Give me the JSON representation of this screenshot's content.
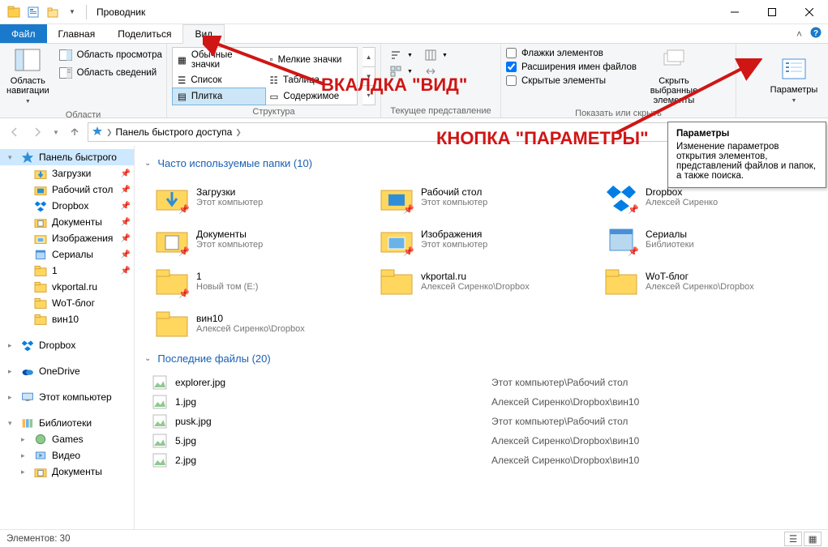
{
  "title": "Проводник",
  "tabs": {
    "file": "Файл",
    "home": "Главная",
    "share": "Поделиться",
    "view": "Вид"
  },
  "ribbon": {
    "panes": {
      "nav": "Область навигации",
      "preview": "Область просмотра",
      "details": "Область сведений",
      "group": "Области"
    },
    "layouts": {
      "huge": "Обычные значки",
      "small": "Мелкие значки",
      "list": "Список",
      "tiles": "Плитка",
      "table": "Таблица",
      "content": "Содержимое",
      "group": "Структура"
    },
    "view": {
      "group": "Текущее представление"
    },
    "show": {
      "checkboxes": "Флажки элементов",
      "extensions": "Расширения имен файлов",
      "hidden": "Скрытые элементы",
      "hide_sel": "Скрыть выбранные элементы",
      "group": "Показать или скрыть"
    },
    "options": {
      "label": "Параметры"
    }
  },
  "breadcrumb": {
    "root": "Панель быстрого доступа"
  },
  "sidebar": [
    {
      "icon": "star",
      "label": "Панель быстрого",
      "sel": true,
      "exp": "▾"
    },
    {
      "icon": "dl",
      "label": "Загрузки",
      "indent": 1,
      "pin": true
    },
    {
      "icon": "desk",
      "label": "Рабочий стол",
      "indent": 1,
      "pin": true
    },
    {
      "icon": "dropbox",
      "label": "Dropbox",
      "indent": 1,
      "pin": true
    },
    {
      "icon": "docs",
      "label": "Документы",
      "indent": 1,
      "pin": true
    },
    {
      "icon": "pics",
      "label": "Изображения",
      "indent": 1,
      "pin": true
    },
    {
      "icon": "lib",
      "label": "Сериалы",
      "indent": 1,
      "pin": true
    },
    {
      "icon": "folder",
      "label": "1",
      "indent": 1,
      "pin": true
    },
    {
      "icon": "folder",
      "label": "vkportal.ru",
      "indent": 1
    },
    {
      "icon": "folder",
      "label": "WoT-блог",
      "indent": 1
    },
    {
      "icon": "folder",
      "label": "вин10",
      "indent": 1
    },
    {
      "spacer": true
    },
    {
      "icon": "dropbox",
      "label": "Dropbox",
      "exp": "▸"
    },
    {
      "spacer": true
    },
    {
      "icon": "onedrive",
      "label": "OneDrive",
      "exp": "▸"
    },
    {
      "spacer": true
    },
    {
      "icon": "pc",
      "label": "Этот компьютер",
      "exp": "▸"
    },
    {
      "spacer": true
    },
    {
      "icon": "libs",
      "label": "Библиотеки",
      "exp": "▾"
    },
    {
      "icon": "games",
      "label": "Games",
      "indent": 1,
      "exp": "▸"
    },
    {
      "icon": "vid",
      "label": "Видео",
      "indent": 1,
      "exp": "▸"
    },
    {
      "icon": "docs",
      "label": "Документы",
      "indent": 1,
      "exp": "▸"
    }
  ],
  "sections": {
    "frequent": {
      "title": "Часто используемые папки (10)"
    },
    "recent": {
      "title": "Последние файлы (20)"
    }
  },
  "folders": [
    {
      "name": "Загрузки",
      "sub": "Этот компьютер",
      "icon": "dl",
      "pin": true
    },
    {
      "name": "Рабочий стол",
      "sub": "Этот компьютер",
      "icon": "desk",
      "pin": true
    },
    {
      "name": "Dropbox",
      "sub": "Алексей Сиренко",
      "icon": "dropbox",
      "pin": true
    },
    {
      "name": "Документы",
      "sub": "Этот компьютер",
      "icon": "docs",
      "pin": true
    },
    {
      "name": "Изображения",
      "sub": "Этот компьютер",
      "icon": "pics",
      "pin": true
    },
    {
      "name": "Сериалы",
      "sub": "Библиотеки",
      "icon": "lib",
      "pin": true
    },
    {
      "name": "1",
      "sub": "Новый том (E:)",
      "icon": "folder",
      "pin": true
    },
    {
      "name": "vkportal.ru",
      "sub": "Алексей Сиренко\\Dropbox",
      "icon": "folder"
    },
    {
      "name": "WoT-блог",
      "sub": "Алексей Сиренко\\Dropbox",
      "icon": "folder"
    },
    {
      "name": "вин10",
      "sub": "Алексей Сиренко\\Dropbox",
      "icon": "folder"
    }
  ],
  "files": [
    {
      "name": "explorer.jpg",
      "path": "Этот компьютер\\Рабочий стол"
    },
    {
      "name": "1.jpg",
      "path": "Алексей Сиренко\\Dropbox\\вин10"
    },
    {
      "name": "pusk.jpg",
      "path": "Этот компьютер\\Рабочий стол"
    },
    {
      "name": "5.jpg",
      "path": "Алексей Сиренко\\Dropbox\\вин10"
    },
    {
      "name": "2.jpg",
      "path": "Алексей Сиренко\\Dropbox\\вин10"
    }
  ],
  "status": {
    "count": "Элементов: 30"
  },
  "tooltip": {
    "title": "Параметры",
    "body": "Изменение параметров открытия элементов, представлений файлов и папок, а также поиска."
  },
  "annotations": {
    "tab": "ВКАЛДКА \"ВИД\"",
    "button": "КНОПКА \"ПАРАМЕТРЫ\""
  }
}
